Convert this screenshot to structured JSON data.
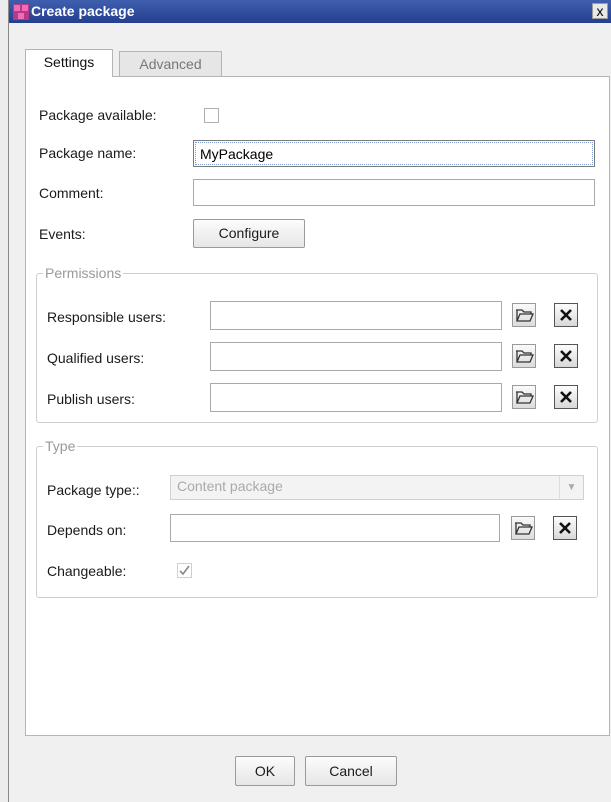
{
  "window": {
    "title": "Create package",
    "close_glyph": "x"
  },
  "tabs": [
    {
      "label": "Settings",
      "active": true
    },
    {
      "label": "Advanced",
      "active": false
    }
  ],
  "settings": {
    "package_available_label": "Package available:",
    "package_available_checked": false,
    "package_name_label": "Package name:",
    "package_name_value": "MyPackage",
    "comment_label": "Comment:",
    "comment_value": "",
    "events_label": "Events:",
    "configure_button": "Configure"
  },
  "permissions": {
    "legend": "Permissions",
    "rows": [
      {
        "label": "Responsible users:",
        "value": ""
      },
      {
        "label": "Qualified users:",
        "value": ""
      },
      {
        "label": "Publish users:",
        "value": ""
      }
    ]
  },
  "type_section": {
    "legend": "Type",
    "package_type_label": "Package type::",
    "package_type_value": "Content package",
    "depends_on_label": "Depends on:",
    "depends_on_value": "",
    "changeable_label": "Changeable:",
    "changeable_checked": true
  },
  "footer": {
    "ok_button": "OK",
    "cancel_button": "Cancel"
  },
  "icons": {
    "app": "package-app-icon",
    "open": "folder-open-icon",
    "clear": "clear-x-icon",
    "dropdown": "chevron-down-icon",
    "check": "checkmark-icon"
  },
  "colors": {
    "titlebar": "#2b4896",
    "app_icon": "#b73a86",
    "panel_bg": "#ffffff",
    "dialog_bg": "#f0f0f0"
  }
}
